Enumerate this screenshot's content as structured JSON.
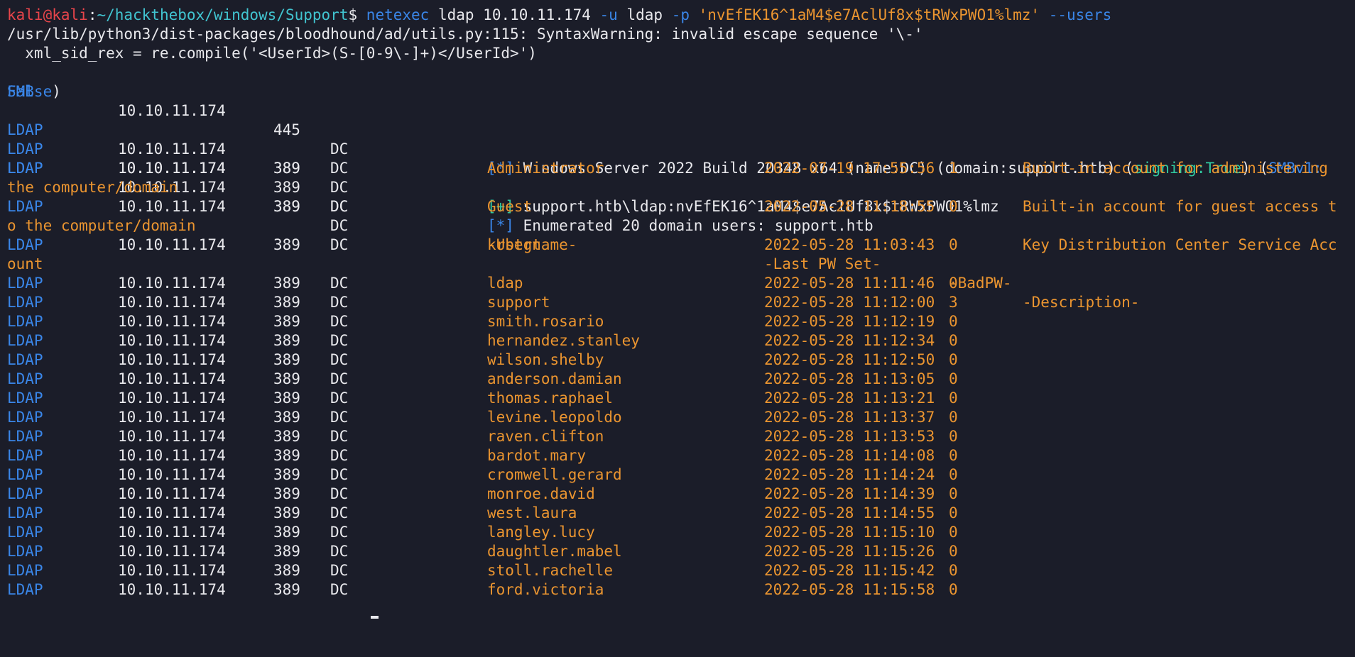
{
  "prompt": {
    "user": "kali",
    "at": "@",
    "host": "kali",
    "colon": ":",
    "path": "~/hackthebox/windows/Support",
    "dollar": "$",
    "cmd_name": "netexec",
    "cmd_args1": " ldap 10.10.11.174 ",
    "flag_u": "-u",
    "user_arg": " ldap ",
    "flag_p": "-p",
    "space": " ",
    "password_arg": "'nvEfEK16^1aM4$e7AclUf8x$tRWxPWO1%lmz'",
    "flag_users": " --users"
  },
  "warning": {
    "line1": "/usr/lib/python3/dist-packages/bloodhound/ad/utils.py:115: SyntaxWarning: invalid escape sequence '\\-'",
    "line2": "  xml_sid_rex = re.compile('<UserId>(S-[0-9\\-]+)</UserId>')"
  },
  "smb": {
    "proto": "SMB",
    "ip": "10.10.11.174",
    "port": "445",
    "name": "DC",
    "marker": "[*]",
    "info": " Windows Server 2022 Build 20348 x64 (name:DC) (domain:support.htb) (",
    "signing": "signing:True",
    "mid": ") (",
    "smbv1_label": "SMBv1:",
    "smbv1_value": "False",
    "close": ")"
  },
  "ldap_auth": {
    "proto": "LDAP",
    "ip": "10.10.11.174",
    "port": "389",
    "name": "DC",
    "marker": "[+]",
    "text": " support.htb\\ldap:nvEfEK16^1aM4$e7AclUf8x$tRWxPWO1%lmz"
  },
  "ldap_enum": {
    "proto": "LDAP",
    "ip": "10.10.11.174",
    "port": "389",
    "name": "DC",
    "marker": "[*]",
    "text": " Enumerated 20 domain users: support.htb"
  },
  "headers": {
    "proto": "LDAP",
    "ip": "10.10.11.174",
    "port": "389",
    "name": "DC",
    "username": "-Username-",
    "last_pw": "-Last PW Set-",
    "badpw": "-BadPW-",
    "description": "-Description-"
  },
  "wrapped_users": [
    {
      "proto": "LDAP",
      "ip": "10.10.11.174",
      "port": "389",
      "name": "DC",
      "username": "Administrator",
      "last_pw": "2022-07-19 17:55:56",
      "badpw": "1",
      "desc": "Built-in account for administering",
      "desc_wrap": "the computer/domain"
    },
    {
      "proto": "LDAP",
      "ip": "10.10.11.174",
      "port": "389",
      "name": "DC",
      "username": "Guest",
      "last_pw": "2022-05-28 11:18:55",
      "badpw": "0",
      "desc": "Built-in account for guest access t",
      "desc_wrap": "o the computer/domain"
    },
    {
      "proto": "LDAP",
      "ip": "10.10.11.174",
      "port": "389",
      "name": "DC",
      "username": "krbtgt",
      "last_pw": "2022-05-28 11:03:43",
      "badpw": "0",
      "desc": "Key Distribution Center Service Acc",
      "desc_wrap": "ount"
    }
  ],
  "users": [
    {
      "proto": "LDAP",
      "ip": "10.10.11.174",
      "port": "389",
      "name": "DC",
      "username": "ldap",
      "last_pw": "2022-05-28 11:11:46",
      "badpw": "0"
    },
    {
      "proto": "LDAP",
      "ip": "10.10.11.174",
      "port": "389",
      "name": "DC",
      "username": "support",
      "last_pw": "2022-05-28 11:12:00",
      "badpw": "3"
    },
    {
      "proto": "LDAP",
      "ip": "10.10.11.174",
      "port": "389",
      "name": "DC",
      "username": "smith.rosario",
      "last_pw": "2022-05-28 11:12:19",
      "badpw": "0"
    },
    {
      "proto": "LDAP",
      "ip": "10.10.11.174",
      "port": "389",
      "name": "DC",
      "username": "hernandez.stanley",
      "last_pw": "2022-05-28 11:12:34",
      "badpw": "0"
    },
    {
      "proto": "LDAP",
      "ip": "10.10.11.174",
      "port": "389",
      "name": "DC",
      "username": "wilson.shelby",
      "last_pw": "2022-05-28 11:12:50",
      "badpw": "0"
    },
    {
      "proto": "LDAP",
      "ip": "10.10.11.174",
      "port": "389",
      "name": "DC",
      "username": "anderson.damian",
      "last_pw": "2022-05-28 11:13:05",
      "badpw": "0"
    },
    {
      "proto": "LDAP",
      "ip": "10.10.11.174",
      "port": "389",
      "name": "DC",
      "username": "thomas.raphael",
      "last_pw": "2022-05-28 11:13:21",
      "badpw": "0"
    },
    {
      "proto": "LDAP",
      "ip": "10.10.11.174",
      "port": "389",
      "name": "DC",
      "username": "levine.leopoldo",
      "last_pw": "2022-05-28 11:13:37",
      "badpw": "0"
    },
    {
      "proto": "LDAP",
      "ip": "10.10.11.174",
      "port": "389",
      "name": "DC",
      "username": "raven.clifton",
      "last_pw": "2022-05-28 11:13:53",
      "badpw": "0"
    },
    {
      "proto": "LDAP",
      "ip": "10.10.11.174",
      "port": "389",
      "name": "DC",
      "username": "bardot.mary",
      "last_pw": "2022-05-28 11:14:08",
      "badpw": "0"
    },
    {
      "proto": "LDAP",
      "ip": "10.10.11.174",
      "port": "389",
      "name": "DC",
      "username": "cromwell.gerard",
      "last_pw": "2022-05-28 11:14:24",
      "badpw": "0"
    },
    {
      "proto": "LDAP",
      "ip": "10.10.11.174",
      "port": "389",
      "name": "DC",
      "username": "monroe.david",
      "last_pw": "2022-05-28 11:14:39",
      "badpw": "0"
    },
    {
      "proto": "LDAP",
      "ip": "10.10.11.174",
      "port": "389",
      "name": "DC",
      "username": "west.laura",
      "last_pw": "2022-05-28 11:14:55",
      "badpw": "0"
    },
    {
      "proto": "LDAP",
      "ip": "10.10.11.174",
      "port": "389",
      "name": "DC",
      "username": "langley.lucy",
      "last_pw": "2022-05-28 11:15:10",
      "badpw": "0"
    },
    {
      "proto": "LDAP",
      "ip": "10.10.11.174",
      "port": "389",
      "name": "DC",
      "username": "daughtler.mabel",
      "last_pw": "2022-05-28 11:15:26",
      "badpw": "0"
    },
    {
      "proto": "LDAP",
      "ip": "10.10.11.174",
      "port": "389",
      "name": "DC",
      "username": "stoll.rachelle",
      "last_pw": "2022-05-28 11:15:42",
      "badpw": "0"
    },
    {
      "proto": "LDAP",
      "ip": "10.10.11.174",
      "port": "389",
      "name": "DC",
      "username": "ford.victoria",
      "last_pw": "2022-05-28 11:15:58",
      "badpw": "0"
    }
  ],
  "colors": {
    "background": "#1b1d29",
    "proto_blue": "#3a86e8",
    "value_orange": "#eb9530",
    "prompt_red": "#e8454b",
    "path_cyan": "#41c4d0",
    "success_green": "#30c9a0"
  }
}
